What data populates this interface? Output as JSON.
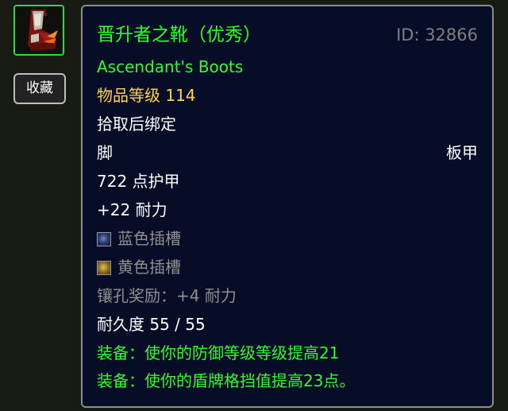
{
  "item": {
    "name": "晋升者之靴（优秀）",
    "id_label": "ID: 32866",
    "english_name": "Ascendant's Boots",
    "item_level": "物品等级 114",
    "bind": "拾取后绑定",
    "slot": "脚",
    "armor_type": "板甲",
    "armor": "722 点护甲",
    "stat": "+22 耐力",
    "socket_blue": "蓝色插槽",
    "socket_yellow": "黄色插槽",
    "socket_bonus": "镶孔奖励：+4 耐力",
    "durability": "耐久度 55 / 55",
    "equip_1": "装备：使你的防御等级等级提高21",
    "equip_2": "装备：使你的盾牌格挡值提高23点。"
  },
  "buttons": {
    "collect": "收藏"
  },
  "icons": {
    "item_icon": "plate-boots-icon",
    "socket_blue_icon": "blue-socket-icon",
    "socket_yellow_icon": "yellow-socket-icon"
  },
  "colors": {
    "quality_green": "#2cff2c",
    "item_level_gold": "#ffd34a",
    "tooltip_bg": "#070d26",
    "inactive_gray": "#8f8f8f"
  }
}
